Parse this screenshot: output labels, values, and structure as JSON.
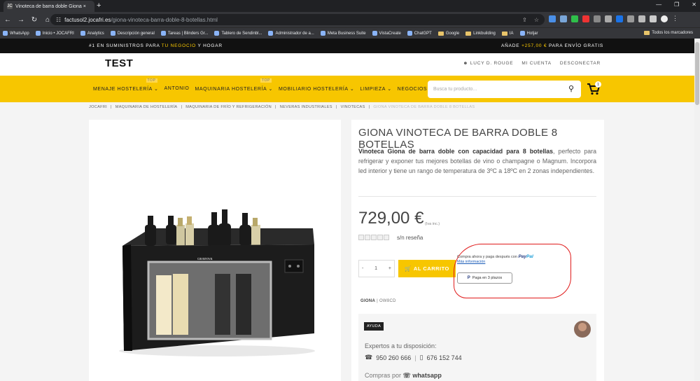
{
  "browser": {
    "tab_title": "Vinoteca de barra doble Giona ×",
    "tab_favicon": "JC",
    "url_host": "factusol2.jocafri.es",
    "url_path": "/giona-vinoteca-barra-doble-8-botellas.html",
    "bookmarks": [
      "WhatsApp",
      "Inicio • JOCAFRI",
      "Analytics",
      "Descripción general",
      "Tareas | Blinders Gr...",
      "Tablero de Sendinbl...",
      "Administrador de a...",
      "Meta Business Suite",
      "VistaCreate",
      "ChatGPT",
      "Google",
      "Linkbuilding",
      "IA",
      "Hotjar"
    ],
    "bookmarks_right": "Todos los marcadores"
  },
  "topstrip": {
    "left_pre": "#1 EN SUMINISTROS PARA ",
    "left_highlight": "TU NEGOCIO",
    "left_post": " Y HOGAR",
    "right_pre": "AÑADE ",
    "right_highlight": "+257,00 €",
    "right_post": " PARA ENVÍO GRATIS"
  },
  "header": {
    "logo": "TEST",
    "user": "LUCY D. ROUGE",
    "account": "MI CUENTA",
    "logout": "DESCONECTAR"
  },
  "menu": {
    "items": [
      "MENAJE HOSTELERÍA",
      "ANTONIO",
      "MAQUINARIA HOSTELERÍA",
      "MOBILIARIO HOSTELERÍA",
      "LIMPIEZA",
      "NEGOCIOS"
    ],
    "top_label": "TOP",
    "search_placeholder": "Busca tu producto...",
    "cart_count": "1"
  },
  "breadcrumb": [
    "JOCAFRI",
    "MAQUINARIA DE HOSTELERÍA",
    "MAQUINARIA DE FRÍO Y REFRIGERACIÓN",
    "NEVERAS INDUSTRIALES",
    "VINOTECAS",
    "GIONA VINOTECA DE BARRA DOBLE 8 BOTELLAS"
  ],
  "product": {
    "title": "GIONA VINOTECA DE BARRA DOBLE 8 BOTELLAS",
    "desc_bold": "Vinoteca Giona de barra doble con capacidad para 8 botellas",
    "desc_rest": ", perfecto para refrigerar y exponer tus mejores botellas de vino o champagne o Magnum. Incorpora led interior y tiene un rango de temperatura de 3ºC a 18ºC en 2 zonas independientes.",
    "price": "729,00 €",
    "iva": "(Iva inc.)",
    "reviews": "s/n reseña",
    "qty": "1",
    "qty_minus": "-",
    "qty_plus": "+",
    "add_to_cart": "AL CARRITO",
    "paypal_text": "Compra ahora y paga después con",
    "paypal_logo_a": "Pay",
    "paypal_logo_b": "Pal",
    "paypal_more": "Más información",
    "paypal_button": "Paga en 3 plazos",
    "brand": "GIONA",
    "sku": "OW8CD",
    "bottle_brand": "cavanova"
  },
  "help": {
    "badge": "AYUDA",
    "title": "Expertos a tu disposición:",
    "phone1": "950 260 666",
    "phone2": "676 152 744",
    "whatsapp_pre": "Compras por",
    "whatsapp": "whatsapp"
  },
  "colors": {
    "accent": "#f7c600",
    "dark": "#111111",
    "annotation": "#e01a1a"
  }
}
